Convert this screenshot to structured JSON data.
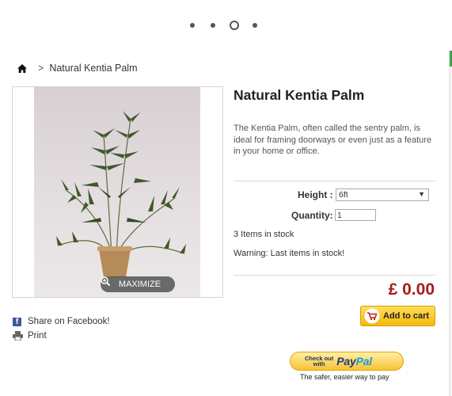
{
  "carousel": {
    "dot_count": 4,
    "active_index": 2
  },
  "breadcrumb": {
    "separator": ">",
    "current": "Natural Kentia Palm"
  },
  "image": {
    "maximize_label": "MAXIMIZE"
  },
  "actions": {
    "share_facebook": "Share on Facebook!",
    "print": "Print"
  },
  "product": {
    "title": "Natural Kentia Palm",
    "description": "The Kentia Palm, often called the sentry palm, is ideal for framing doorways or even just as a feature in your home or office.",
    "height_label": "Height :",
    "height_value": "6ft",
    "quantity_label": "Quantity:",
    "quantity_value": "1",
    "stock_text": "3 Items in stock",
    "warning_text": "Warning: Last items in stock!",
    "price": "£ 0.00",
    "add_to_cart": "Add to cart"
  },
  "paypal": {
    "check_out": "Check out",
    "with": "with",
    "pay": "Pay",
    "pal": "Pal",
    "tagline": "The safer, easier way to pay"
  },
  "colors": {
    "price": "#a51c1c",
    "cart_button": "#f2b90d",
    "facebook": "#3b5998",
    "accent_green": "#3aa64b"
  },
  "icons": [
    "home-icon",
    "zoom-icon",
    "facebook-icon",
    "print-icon",
    "cart-icon",
    "chevron-down-icon"
  ]
}
